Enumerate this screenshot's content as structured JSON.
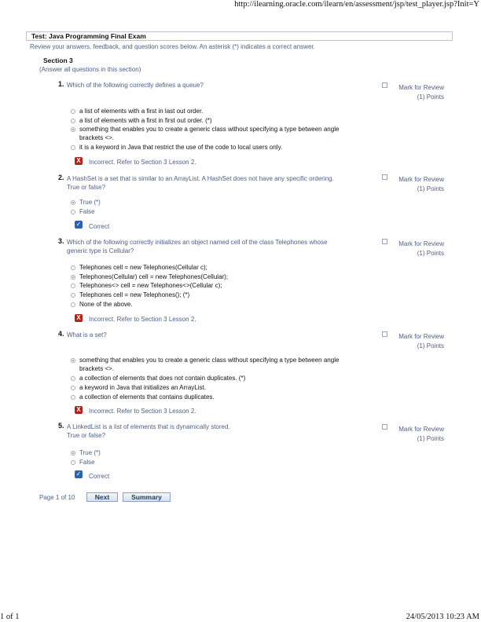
{
  "page_header": {
    "url": "http://ilearning.oracle.com/ilearn/en/assessment/jsp/test_player.jsp?Init=Y"
  },
  "exam": {
    "title": "Test: Java Programming Final Exam",
    "instructions": "Review your answers, feedback, and question scores below. An asterisk (*) indicates a correct answer."
  },
  "section": {
    "title": "Section 3",
    "subtitle": "(Answer all questions in this section)"
  },
  "common": {
    "mark_for_review": "Mark for Review",
    "points": "(1) Points"
  },
  "questions": [
    {
      "number": "1.",
      "text_lines": [
        "Which of the following correctly defines a queue?"
      ],
      "options": [
        "a list of elements with a first in last out order.",
        "a list of elements with a first in first out order. (*)",
        "something that enables you to create a generic class without specifying a type between angle",
        "brackets <>.",
        "it is a keyword in Java that restrict the use of the code to local users only."
      ],
      "feedback": "Incorrect. Refer to Section 3 Lesson 2."
    },
    {
      "number": "2.",
      "text_lines": [
        "A HashSet is a set that is similar to an ArrayList. A HashSet does not have any specific ordering.",
        "True or false?"
      ],
      "options": [
        "True (*)",
        "False"
      ],
      "feedback": "Correct"
    },
    {
      "number": "3.",
      "text_lines": [
        "Which of the following correctly initializes an object named cell of the class Telephones whose",
        "generic type is Cellular?"
      ],
      "options": [
        "Telephones cell = new Telephones(Cellular c);",
        "Telephones(Cellular) cell = new Telephones(Cellular);",
        "Telephones<> cell = new Telephones<>(Cellular c);",
        "Telephones cell = new Telephones(); (*)",
        "None of the above."
      ],
      "feedback": "Incorrect. Refer to Section 3 Lesson 2."
    },
    {
      "number": "4.",
      "text_lines": [
        "What is a set?"
      ],
      "options": [
        "something that enables you to create a generic class without specifying a type between angle",
        "brackets <>.",
        "a collection of elements that does not contain duplicates. (*)",
        "a keyword in Java that initializes an ArrayList.",
        "a collection of elements that contains duplicates."
      ],
      "feedback": "Incorrect. Refer to Section 3 Lesson 2."
    },
    {
      "number": "5.",
      "text_lines": [
        "A LinkedList is a list of elements that is dynamically stored.",
        "True or false?"
      ],
      "options": [
        "True (*)",
        "False"
      ],
      "feedback": "Correct"
    }
  ],
  "pagination": {
    "label": "Page 1 of 10",
    "next": "Next",
    "summary": "Summary"
  },
  "page_footer": {
    "left": "1 of 1",
    "right": "24/05/2013 10:23 AM"
  }
}
